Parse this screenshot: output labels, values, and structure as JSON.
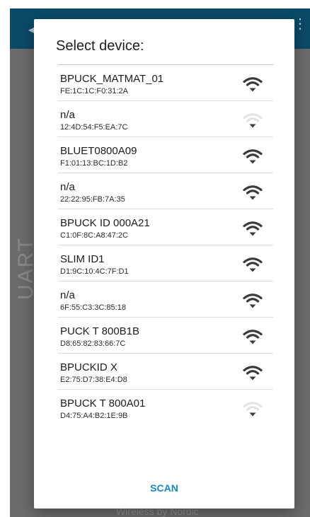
{
  "background_app": {
    "side_label": "UART",
    "footer_text": "Wireless by Nordic"
  },
  "dialog": {
    "title": "Select device:",
    "scan_label": "SCAN"
  },
  "devices": [
    {
      "name": "BPUCK_MATMAT_01",
      "address": "FE:1C:1C:F0:31:2A",
      "signal": "strong"
    },
    {
      "name": "n/a",
      "address": "12:4D:54:F5:EA:7C",
      "signal": "weak"
    },
    {
      "name": "BLUET0800A09",
      "address": "F1:01:13:BC:1D:B2",
      "signal": "strong"
    },
    {
      "name": "n/a",
      "address": "22:22:95:FB:7A:35",
      "signal": "strong"
    },
    {
      "name": "BPUCK ID 000A21",
      "address": "C1:0F:8C:A8:47:2C",
      "signal": "strong"
    },
    {
      "name": "SLIM ID1",
      "address": "D1:9C:10:4C:7F:D1",
      "signal": "strong"
    },
    {
      "name": "n/a",
      "address": "6F:55:C3:3C:85:18",
      "signal": "strong"
    },
    {
      "name": "PUCK T 800B1B",
      "address": "D8:65:82:83:66:7C",
      "signal": "strong"
    },
    {
      "name": "BPUCKID X",
      "address": "E2:75:D7:38:E4:D8",
      "signal": "strong"
    },
    {
      "name": "BPUCK T 800A01",
      "address": "D4:75:A4:B2:1E:9B",
      "signal": "weak"
    }
  ],
  "colors": {
    "app_bar": "#0b4a66",
    "accent": "#1a86c4",
    "signal_active": "#3a3a3a",
    "signal_inactive": "#e4e4e4"
  }
}
